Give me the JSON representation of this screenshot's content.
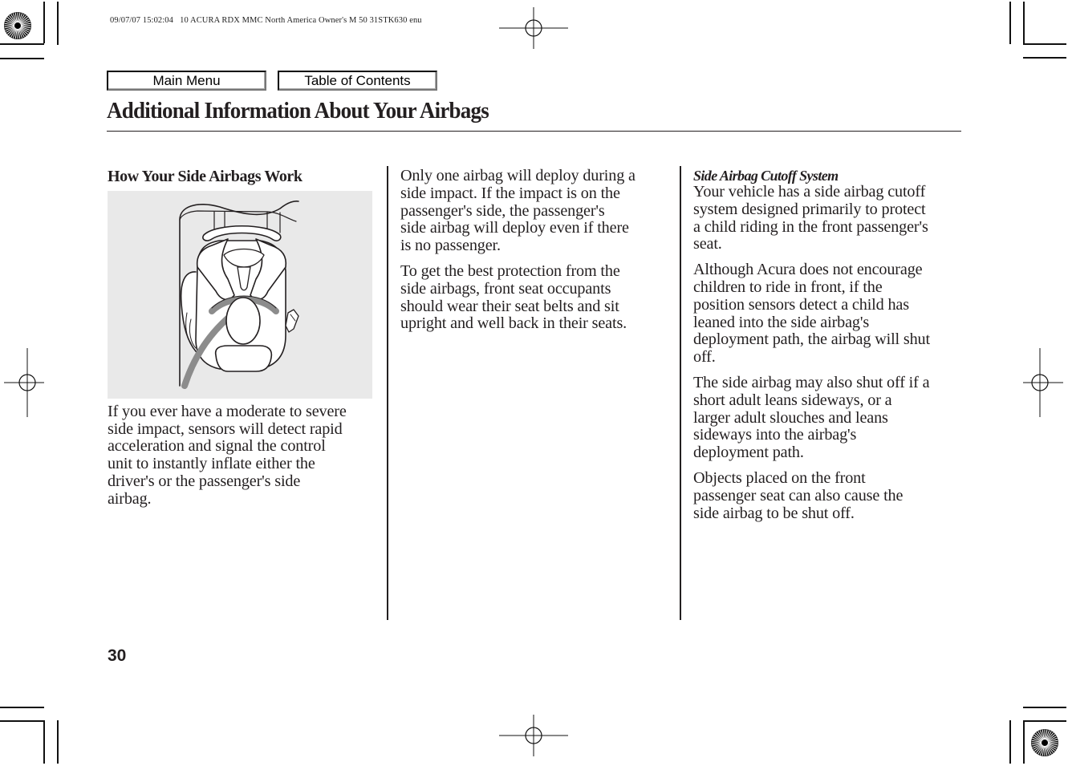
{
  "print_header": "09/07/07 15:02:04   10 ACURA RDX MMC North America Owner's M 50 31STK630 enu",
  "nav": {
    "main_menu_label": "Main Menu",
    "toc_label": "Table of Contents"
  },
  "page": {
    "title": "Additional Information About Your Airbags",
    "number": "30"
  },
  "columns": {
    "left": {
      "heading": "How Your Side Airbags Work",
      "figure_icon": "driver-seated-top-view-illustration",
      "paragraph": "If you ever have a moderate to severe\nside impact, sensors will detect rapid\nacceleration and signal the control\nunit to instantly inflate either the\ndriver's or the passenger's side\nairbag."
    },
    "middle": {
      "paragraphs": [
        "Only one airbag will deploy during a\nside impact. If the impact is on the\npassenger's side, the passenger's\nside airbag will deploy even if there\nis no passenger.",
        "To get the best protection from the\nside airbags, front seat occupants\nshould wear their seat belts and sit\nupright and well back in their seats."
      ]
    },
    "right": {
      "subheading": "Side Airbag Cutoff System",
      "paragraphs": [
        "Your vehicle has a side airbag cutoff\nsystem designed primarily to protect\na child riding in the front passenger's\nseat.",
        "Although Acura does not encourage\nchildren to ride in front, if the\nposition sensors detect a child has\nleaned into the side airbag's\ndeployment path, the airbag will shut\noff.",
        "The side airbag may also shut off if a\nshort adult leans sideways, or a\nlarger adult slouches and leans\nsideways into the airbag's\ndeployment path.",
        "Objects placed on the front\npassenger seat can also cause the\nside airbag to be shut off."
      ]
    }
  },
  "colors": {
    "text": "#231f20",
    "figure_background": "#e9e9e9",
    "belt_gray": "#8c8c8c"
  }
}
